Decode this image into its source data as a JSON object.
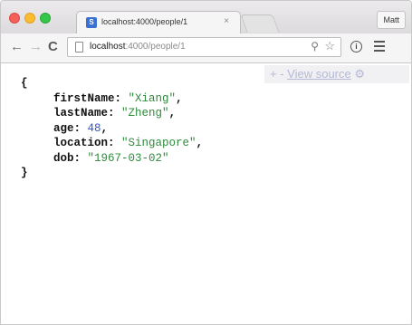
{
  "browser": {
    "tab": {
      "favicon_letter": "S",
      "title": "localhost:4000/people/1",
      "close": "×"
    },
    "profile_button": "Matt",
    "toolbar": {
      "back": "←",
      "forward": "→",
      "reload": "C",
      "url_host": "localhost",
      "url_path": ":4000/people/1",
      "zoom_glyph": "⚲",
      "star_glyph": "☆",
      "info_glyph": "i"
    }
  },
  "viewer": {
    "controls": "+ -",
    "view_source": "View source",
    "settings_glyph": "⚙"
  },
  "json": {
    "open_brace": "{",
    "close_brace": "}",
    "fields": [
      {
        "key": "firstName",
        "value": "\"Xiang\"",
        "type": "string",
        "trail": ","
      },
      {
        "key": "lastName",
        "value": "\"Zheng\"",
        "type": "string",
        "trail": ","
      },
      {
        "key": "age",
        "value": "48",
        "type": "number",
        "trail": ","
      },
      {
        "key": "location",
        "value": "\"Singapore\"",
        "type": "string",
        "trail": ","
      },
      {
        "key": "dob",
        "value": "\"1967-03-02\"",
        "type": "string",
        "trail": ""
      }
    ]
  },
  "colors": {
    "string": "#2e8b3c",
    "number": "#2f56c6",
    "close_light": "#f4605a",
    "minimize_light": "#fbbd2f",
    "zoom_light": "#35c74a"
  }
}
